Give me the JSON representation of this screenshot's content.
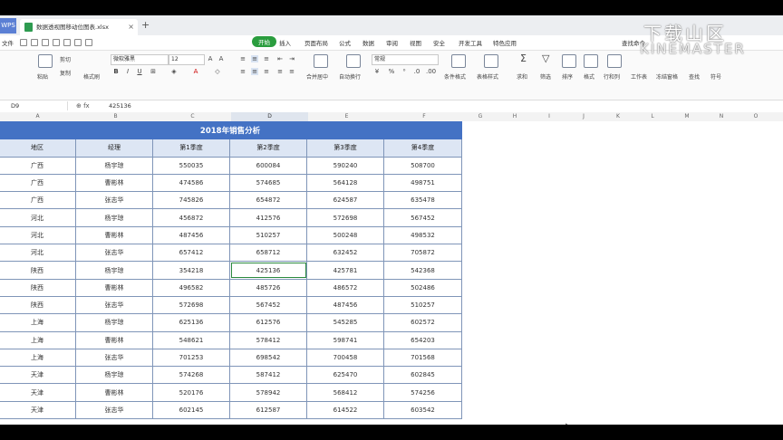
{
  "titlebar": {
    "app_label": "WPS",
    "doc_tab_name": "数据透视图移动位图表.xlsx",
    "close_glyph": "×",
    "new_tab_glyph": "+"
  },
  "menubar": {
    "file_label": "文件",
    "tabs": [
      "开始",
      "插入",
      "页面布局",
      "公式",
      "数据",
      "审阅",
      "视图",
      "安全",
      "开发工具",
      "特色应用"
    ],
    "search_label": "查找命令"
  },
  "ribbon": {
    "paste": "粘贴",
    "cut": "剪切",
    "copy": "复制",
    "format_painter": "格式刷",
    "font_name": "微软雅黑",
    "font_size": "12",
    "merge_center": "合并居中",
    "wrap_text": "自动换行",
    "number_format": "常规",
    "conditional_format": "条件格式",
    "table_style": "表格样式",
    "sum": "求和",
    "filter": "筛选",
    "sort": "排序",
    "format": "格式",
    "rows_cols": "行和列",
    "worksheet": "工作表",
    "freeze": "冻结窗格",
    "find": "查找",
    "symbol": "符号"
  },
  "watermark": {
    "line1": "下载山区",
    "line2": "KINEMASTER"
  },
  "formula_bar": {
    "cell_ref": "D9",
    "fx_label": "fx",
    "value": "425136"
  },
  "columns": [
    "A",
    "B",
    "C",
    "D",
    "E",
    "F",
    "G",
    "H",
    "I",
    "J",
    "K",
    "L",
    "M",
    "N",
    "O"
  ],
  "table": {
    "title": "2018年销售分析",
    "headers": [
      "地区",
      "经理",
      "第1季度",
      "第2季度",
      "第3季度",
      "第4季度"
    ],
    "rows": [
      [
        "广西",
        "杨宇琼",
        "550035",
        "600084",
        "590240",
        "508700"
      ],
      [
        "广西",
        "曹彬林",
        "474586",
        "574685",
        "564128",
        "498751"
      ],
      [
        "广西",
        "张志华",
        "745826",
        "654872",
        "624587",
        "635478"
      ],
      [
        "河北",
        "杨宇琼",
        "456872",
        "412576",
        "572698",
        "567452"
      ],
      [
        "河北",
        "曹彬林",
        "487456",
        "510257",
        "500248",
        "498532"
      ],
      [
        "河北",
        "张志华",
        "657412",
        "658712",
        "632452",
        "705872"
      ],
      [
        "陕西",
        "杨宇琼",
        "354218",
        "425136",
        "425781",
        "542368"
      ],
      [
        "陕西",
        "曹彬林",
        "496582",
        "485726",
        "486572",
        "502486"
      ],
      [
        "陕西",
        "张志华",
        "572698",
        "567452",
        "487456",
        "510257"
      ],
      [
        "上海",
        "杨宇琼",
        "625136",
        "612576",
        "545285",
        "602572"
      ],
      [
        "上海",
        "曹彬林",
        "548621",
        "578412",
        "598741",
        "654203"
      ],
      [
        "上海",
        "张志华",
        "701253",
        "698542",
        "700458",
        "701568"
      ],
      [
        "天津",
        "杨宇琼",
        "574268",
        "587412",
        "625470",
        "602845"
      ],
      [
        "天津",
        "曹彬林",
        "520176",
        "578942",
        "568412",
        "574256"
      ],
      [
        "天津",
        "张志华",
        "602145",
        "612587",
        "614522",
        "603542"
      ]
    ]
  }
}
